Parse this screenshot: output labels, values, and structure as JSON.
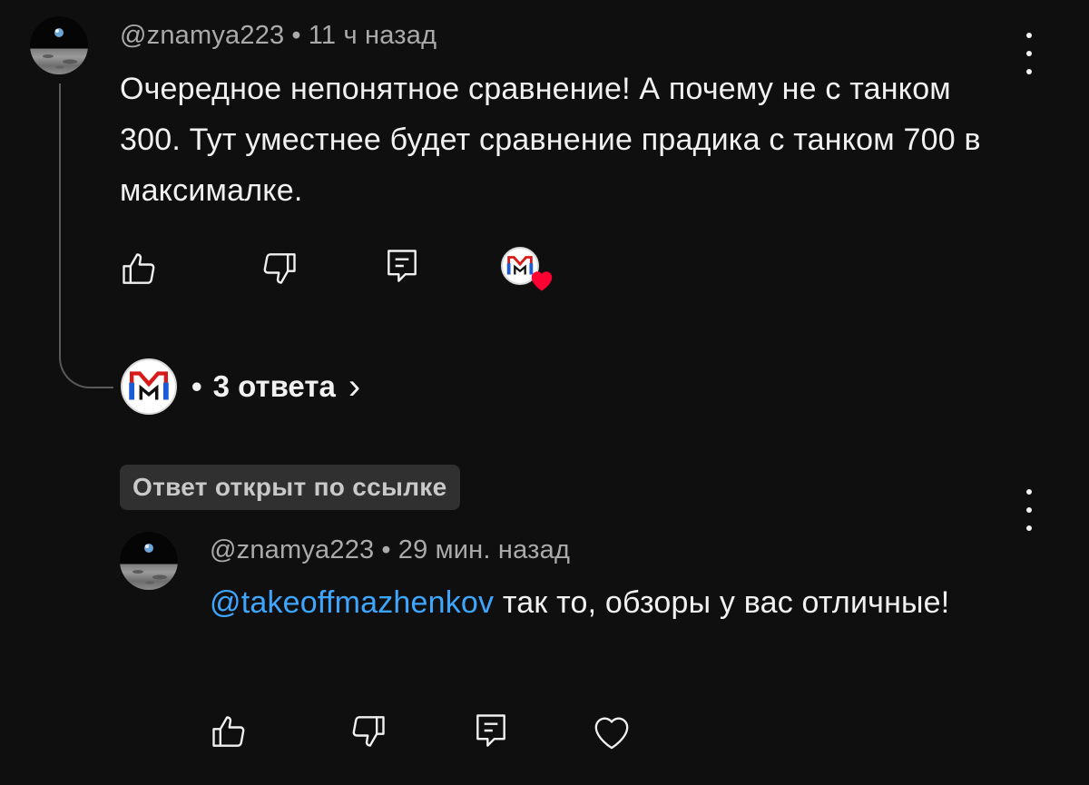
{
  "comment": {
    "author": "@znamya223",
    "separator": "•",
    "time": "11 ч назад",
    "text": "Очередное непонятное сравнение! А почему не с танком 300. Тут уместнее будет сравнение прадика с танком 700 в максималке.",
    "actions": {
      "like_icon": "thumbs-up-icon",
      "dislike_icon": "thumbs-down-icon",
      "reply_icon": "reply-icon",
      "creator_heart_icon": "creator-heart-icon"
    },
    "replies": {
      "bullet": "•",
      "label": "3 ответа",
      "chevron": "›"
    }
  },
  "linked_reply": {
    "badge": "Ответ открыт по ссылке",
    "author": "@znamya223",
    "separator": "•",
    "time": "29 мин. назад",
    "mention": "@takeoffmazhenkov",
    "text": " так то, обзоры у вас отличные!",
    "actions": {
      "like_icon": "thumbs-up-icon",
      "dislike_icon": "thumbs-down-icon",
      "reply_icon": "reply-icon",
      "heart_icon": "heart-icon"
    }
  },
  "colors": {
    "background": "#0f0f0f",
    "text": "#f1f1f1",
    "meta": "#aaaaaa",
    "mention": "#3ea6ff",
    "heart": "#ff0033",
    "badge_bg": "#303030"
  }
}
